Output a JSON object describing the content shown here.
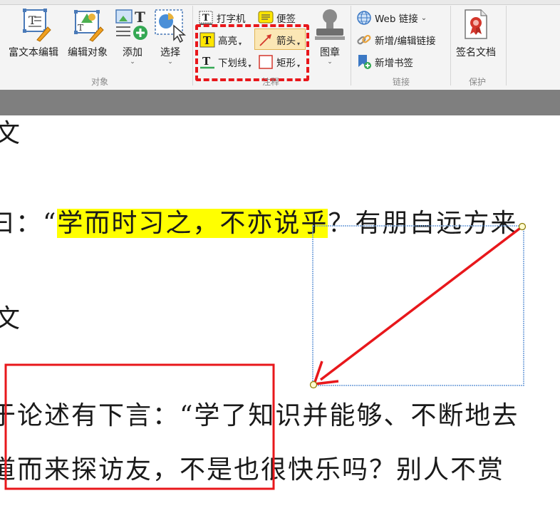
{
  "ribbon": {
    "objects_group": {
      "label": "对象",
      "buttons": [
        {
          "label": "富文本编辑",
          "icon": "rich-text-edit-icon"
        },
        {
          "label": "编辑对象",
          "icon": "edit-object-icon"
        },
        {
          "label": "添加",
          "icon": "add-icon"
        },
        {
          "label": "选择",
          "icon": "select-icon"
        }
      ]
    },
    "annotation_group": {
      "label": "注释",
      "typewriter": "打字机",
      "sticky_note": "便签",
      "highlight": "高亮",
      "arrow": "箭头",
      "underline": "下划线",
      "rectangle": "矩形"
    },
    "stamp": {
      "label": "图章"
    },
    "links_group": {
      "label": "链接",
      "web_link": "Web 链接",
      "new_edit_link": "新增/编辑链接",
      "new_bookmark": "新增书签"
    },
    "protect_group": {
      "label": "保护",
      "sign_document": "签名文档"
    }
  },
  "document": {
    "line1": "文",
    "line2_prefix": "曰：“",
    "line2_highlight": "学而时习之，不亦说乎",
    "line2_suffix": "？有朋自远方来",
    "line3": "文",
    "line4": "于论述有下言：“学了知识并能够、不断地去",
    "line5": "道而来探访友，不是也很快乐吗？别人不赏"
  },
  "colors": {
    "highlight": "#ffff00",
    "annotation_red": "#e8171b",
    "selection_blue": "#6b9bd8",
    "arrow_tool_active": "#fbe7b5"
  }
}
